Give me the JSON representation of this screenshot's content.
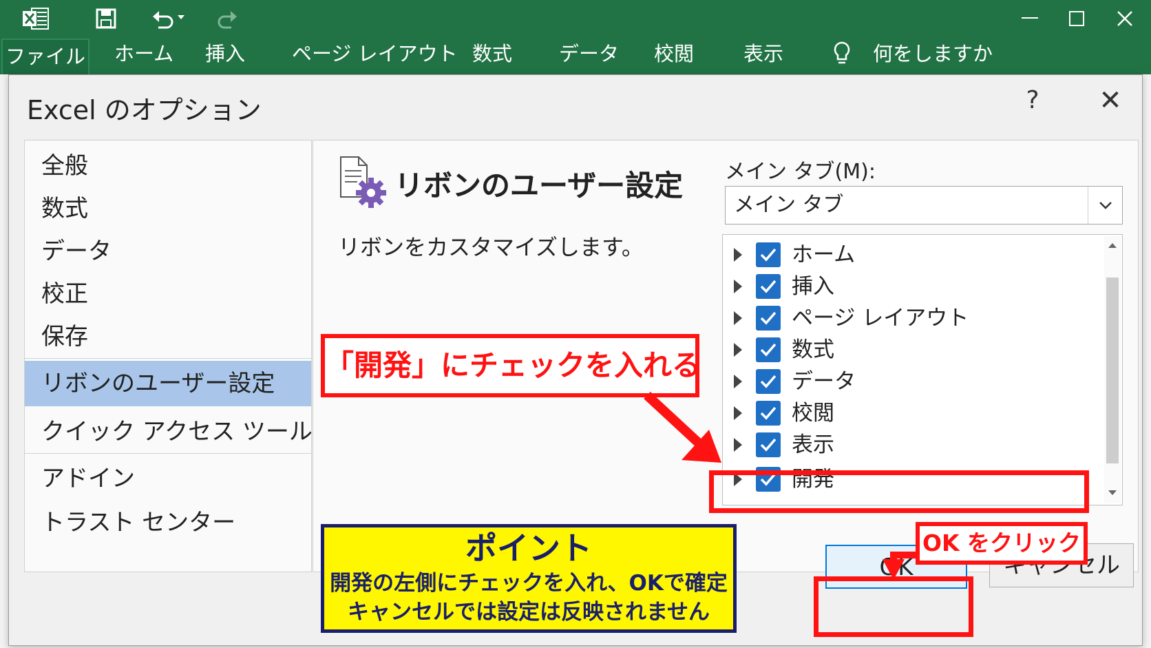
{
  "excel": {
    "qat": [
      "excel-logo-icon",
      "save-icon",
      "undo-icon",
      "redo-icon"
    ],
    "window_controls": [
      "minimize-icon",
      "maximize-icon",
      "close-icon"
    ],
    "ribbon_tabs": [
      "ファイル",
      "ホーム",
      "挿入",
      "ページ レイアウト",
      "数式",
      "データ",
      "校閲",
      "表示"
    ],
    "tell_me": "何をしますか",
    "colors": {
      "ribbon": "#217346",
      "accent_blue": "#1f6fc5",
      "selection": "#a9c6ea",
      "annotation_red": "#ff1212",
      "point_yellow": "#fff700",
      "point_navy": "#1a1f6b"
    }
  },
  "dialog": {
    "title": "Excel のオプション",
    "help": "?",
    "close": "✕",
    "nav": [
      "全般",
      "数式",
      "データ",
      "校正",
      "保存",
      "リボンのユーザー設定",
      "クイック アクセス ツール バー",
      "アドイン",
      "トラスト センター"
    ],
    "selected_nav": "リボンのユーザー設定",
    "panel": {
      "title": "リボンのユーザー設定",
      "description": "リボンをカスタマイズします。",
      "combo_label": "メイン タブ(M):",
      "combo_value": "メイン タブ",
      "tabs": [
        {
          "label": "ホーム",
          "checked": true
        },
        {
          "label": "挿入",
          "checked": true
        },
        {
          "label": "ページ レイアウト",
          "checked": true
        },
        {
          "label": "数式",
          "checked": true
        },
        {
          "label": "データ",
          "checked": true
        },
        {
          "label": "校閲",
          "checked": true
        },
        {
          "label": "表示",
          "checked": true
        },
        {
          "label": "開発",
          "checked": true
        }
      ]
    },
    "ok": "OK",
    "cancel": "キャンセル"
  },
  "annotations": {
    "callout_dev": "「開発」にチェックを入れる",
    "callout_ok": "OK をクリック",
    "point_title": "ポイント",
    "point_line1": "開発の左側にチェックを入れ、OKで確定",
    "point_line2": "キャンセルでは設定は反映されません"
  }
}
